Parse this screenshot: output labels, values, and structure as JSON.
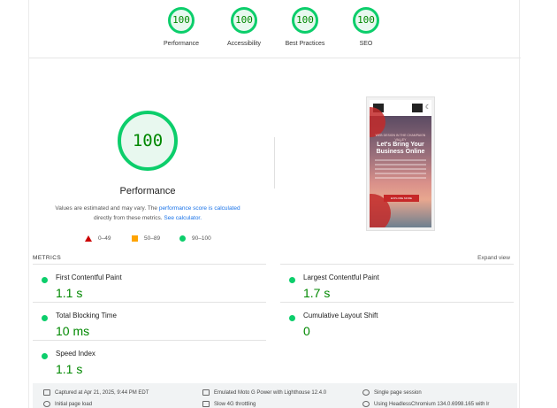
{
  "categories": [
    {
      "score": "100",
      "label": "Performance"
    },
    {
      "score": "100",
      "label": "Accessibility"
    },
    {
      "score": "100",
      "label": "Best Practices"
    },
    {
      "score": "100",
      "label": "SEO"
    }
  ],
  "main": {
    "score": "100",
    "title": "Performance",
    "note_prefix": "Values are estimated and may vary. The ",
    "note_link1": "performance score is calculated",
    "note_middle": " directly from these metrics. ",
    "note_link2": "See calculator.",
    "legend": [
      {
        "range": "0–49",
        "color": "#cc0000"
      },
      {
        "range": "50–89",
        "color": "#ffa400"
      },
      {
        "range": "90–100",
        "color": "#0cce6b"
      }
    ]
  },
  "preview": {
    "kicker": "WEB DESIGN IN THE CHAMPAIGN VALLEY",
    "headline": "Let's Bring Your Business Online",
    "button": "EXPLORE MORE"
  },
  "metrics": {
    "header": "METRICS",
    "expand": "Expand view",
    "items": [
      {
        "name": "First Contentful Paint",
        "value": "1.1 s"
      },
      {
        "name": "Largest Contentful Paint",
        "value": "1.7 s"
      },
      {
        "name": "Total Blocking Time",
        "value": "10 ms"
      },
      {
        "name": "Cumulative Layout Shift",
        "value": "0"
      },
      {
        "name": "Speed Index",
        "value": "1.1 s"
      }
    ]
  },
  "footer": {
    "captured": "Captured at Apr 21, 2025, 9:44 PM EDT",
    "emulated": "Emulated Moto G Power with Lighthouse 12.4.0",
    "session": "Single page session",
    "initial": "Initial page load",
    "throttling": "Slow 4G throttling",
    "browser": "Using HeadlessChromium 134.0.6998.165 with lr"
  },
  "colors": {
    "pass": "#0cce6b",
    "pass_text": "#008800",
    "average": "#ffa400",
    "fail": "#cc0000",
    "link": "#1a73e8"
  }
}
